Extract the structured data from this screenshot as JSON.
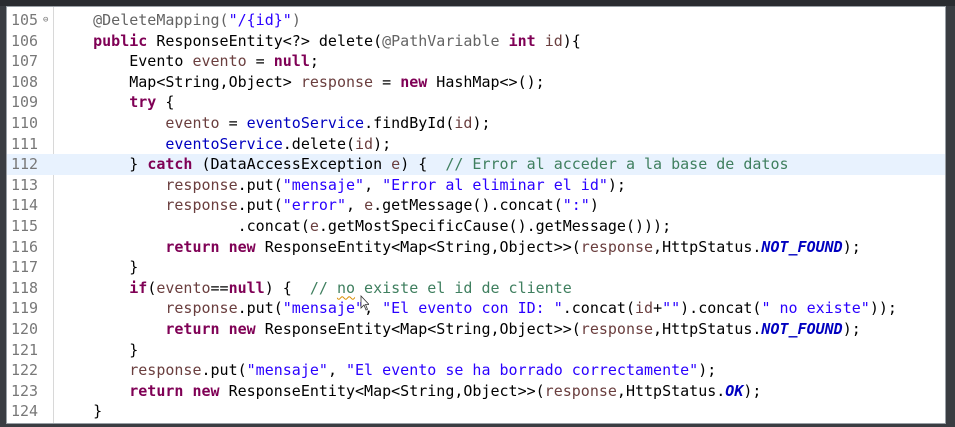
{
  "editor": {
    "lines": [
      {
        "num": "105",
        "fold": true,
        "parts": [
          [
            "i",
            "    "
          ],
          [
            "ann",
            "@DeleteMapping("
          ],
          [
            "str",
            "\"/{id}\""
          ],
          [
            "ann",
            ")"
          ]
        ]
      },
      {
        "num": "106",
        "parts": [
          [
            "i",
            "    "
          ],
          [
            "kw",
            "public"
          ],
          [
            "t",
            " ResponseEntity<?> delete("
          ],
          [
            "ann",
            "@PathVariable"
          ],
          [
            "t",
            " "
          ],
          [
            "kw",
            "int"
          ],
          [
            "t",
            " "
          ],
          [
            "var",
            "id"
          ],
          [
            "t",
            "){"
          ]
        ]
      },
      {
        "num": "107",
        "parts": [
          [
            "i",
            "        "
          ],
          [
            "t",
            "Evento "
          ],
          [
            "var",
            "evento"
          ],
          [
            "t",
            " = "
          ],
          [
            "kw",
            "null"
          ],
          [
            "t",
            ";"
          ]
        ]
      },
      {
        "num": "108",
        "parts": [
          [
            "i",
            "        "
          ],
          [
            "t",
            "Map<String,Object> "
          ],
          [
            "var",
            "response"
          ],
          [
            "t",
            " = "
          ],
          [
            "kw",
            "new"
          ],
          [
            "t",
            " HashMap<>();"
          ]
        ]
      },
      {
        "num": "109",
        "parts": [
          [
            "i",
            "        "
          ],
          [
            "kw",
            "try"
          ],
          [
            "t",
            " {"
          ]
        ]
      },
      {
        "num": "110",
        "parts": [
          [
            "i",
            "            "
          ],
          [
            "var",
            "evento"
          ],
          [
            "t",
            " = "
          ],
          [
            "fld",
            "eventoService"
          ],
          [
            "t",
            ".findById("
          ],
          [
            "var",
            "id"
          ],
          [
            "t",
            ");"
          ]
        ]
      },
      {
        "num": "111",
        "parts": [
          [
            "i",
            "            "
          ],
          [
            "fld",
            "eventoService"
          ],
          [
            "t",
            ".delete("
          ],
          [
            "var",
            "id"
          ],
          [
            "t",
            ");"
          ]
        ]
      },
      {
        "num": "112",
        "current": true,
        "parts": [
          [
            "i",
            "        "
          ],
          [
            "t",
            "} "
          ],
          [
            "kw",
            "catch"
          ],
          [
            "t",
            " (DataAccessException "
          ],
          [
            "var",
            "e"
          ],
          [
            "t",
            ") {  "
          ],
          [
            "cmt",
            "// Error al acceder a la base de datos"
          ]
        ]
      },
      {
        "num": "113",
        "parts": [
          [
            "i",
            "            "
          ],
          [
            "var",
            "response"
          ],
          [
            "t",
            ".put("
          ],
          [
            "str",
            "\"mensaje\""
          ],
          [
            "t",
            ", "
          ],
          [
            "str",
            "\"Error al eliminar el id\""
          ],
          [
            "t",
            ");"
          ]
        ]
      },
      {
        "num": "114",
        "parts": [
          [
            "i",
            "            "
          ],
          [
            "var",
            "response"
          ],
          [
            "t",
            ".put("
          ],
          [
            "str",
            "\"error\""
          ],
          [
            "t",
            ", "
          ],
          [
            "var",
            "e"
          ],
          [
            "t",
            ".getMessage().concat("
          ],
          [
            "str",
            "\":\""
          ],
          [
            "t",
            ")"
          ]
        ]
      },
      {
        "num": "115",
        "parts": [
          [
            "i",
            "                    "
          ],
          [
            "t",
            ".concat("
          ],
          [
            "var",
            "e"
          ],
          [
            "t",
            ".getMostSpecificCause().getMessage()));"
          ]
        ]
      },
      {
        "num": "116",
        "parts": [
          [
            "i",
            "            "
          ],
          [
            "kw",
            "return"
          ],
          [
            "t",
            " "
          ],
          [
            "kw",
            "new"
          ],
          [
            "t",
            " ResponseEntity<Map<String,Object>>("
          ],
          [
            "var",
            "response"
          ],
          [
            "t",
            ",HttpStatus."
          ],
          [
            "const",
            "NOT_FOUND"
          ],
          [
            "t",
            ");"
          ]
        ]
      },
      {
        "num": "117",
        "parts": [
          [
            "i",
            "        "
          ],
          [
            "t",
            "}"
          ]
        ]
      },
      {
        "num": "118",
        "parts": [
          [
            "i",
            "        "
          ],
          [
            "kw",
            "if"
          ],
          [
            "t",
            "("
          ],
          [
            "var",
            "evento"
          ],
          [
            "t",
            "=="
          ],
          [
            "kw",
            "null"
          ],
          [
            "t",
            ") {  "
          ],
          [
            "cmt",
            "// "
          ],
          [
            "cmtsq",
            "no"
          ],
          [
            "cmt",
            " existe el id de cliente"
          ]
        ]
      },
      {
        "num": "119",
        "parts": [
          [
            "i",
            "            "
          ],
          [
            "var",
            "response"
          ],
          [
            "t",
            ".put("
          ],
          [
            "str",
            "\"mensaje\""
          ],
          [
            "t",
            ", "
          ],
          [
            "str",
            "\"El evento con ID: \""
          ],
          [
            "t",
            ".concat("
          ],
          [
            "var",
            "id"
          ],
          [
            "t",
            "+"
          ],
          [
            "str",
            "\"\""
          ],
          [
            "t",
            ").concat("
          ],
          [
            "str",
            "\" no existe\""
          ],
          [
            "t",
            "));"
          ]
        ]
      },
      {
        "num": "120",
        "parts": [
          [
            "i",
            "            "
          ],
          [
            "kw",
            "return"
          ],
          [
            "t",
            " "
          ],
          [
            "kw",
            "new"
          ],
          [
            "t",
            " ResponseEntity<Map<String,Object>>("
          ],
          [
            "var",
            "response"
          ],
          [
            "t",
            ",HttpStatus."
          ],
          [
            "const",
            "NOT_FOUND"
          ],
          [
            "t",
            ");"
          ]
        ]
      },
      {
        "num": "121",
        "parts": [
          [
            "i",
            "        "
          ],
          [
            "t",
            "}"
          ]
        ]
      },
      {
        "num": "122",
        "parts": [
          [
            "i",
            "        "
          ],
          [
            "var",
            "response"
          ],
          [
            "t",
            ".put("
          ],
          [
            "str",
            "\"mensaje\""
          ],
          [
            "t",
            ", "
          ],
          [
            "str",
            "\"El evento se ha borrado correctamente\""
          ],
          [
            "t",
            ");"
          ]
        ]
      },
      {
        "num": "123",
        "parts": [
          [
            "i",
            "        "
          ],
          [
            "kw",
            "return"
          ],
          [
            "t",
            " "
          ],
          [
            "kw",
            "new"
          ],
          [
            "t",
            " ResponseEntity<Map<String,Object>>("
          ],
          [
            "var",
            "response"
          ],
          [
            "t",
            ",HttpStatus."
          ],
          [
            "const",
            "OK"
          ],
          [
            "t",
            ");"
          ]
        ]
      },
      {
        "num": "124",
        "parts": [
          [
            "i",
            "    "
          ],
          [
            "t",
            "}"
          ]
        ]
      }
    ]
  },
  "colors": {
    "keyword": "#7f0055",
    "annotation": "#646464",
    "string": "#2a00ff",
    "comment": "#3f7f5f",
    "field": "#0000c0",
    "local_variable": "#6a3e3e",
    "current_line": "#e8f2fe"
  }
}
